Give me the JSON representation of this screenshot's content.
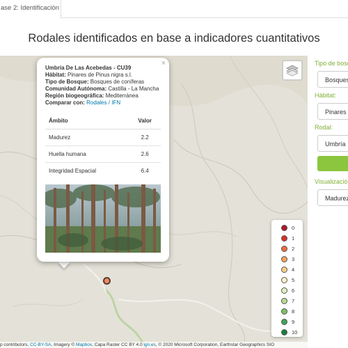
{
  "tab": {
    "label": "ase 2: Identificación"
  },
  "page_title": "Rodales identificados en base a indicadores cuantitativos",
  "popup": {
    "close": "×",
    "name": "Umbría De Las Acebedas - CU39",
    "habitat_label": "Hábitat:",
    "habitat_value": "Pinares de Pinus nigra s.l.",
    "forest_label": "Tipo de Bosque:",
    "forest_value": "Bosques de coníferas",
    "community_label": "Comunidad Autónoma:",
    "community_value": "Castilla - La Mancha",
    "region_label": "Región biogeográfica:",
    "region_value": "Mediterránea",
    "compare_label": "Comparar con:",
    "compare_rodales": "Rodales",
    "compare_sep": "/",
    "compare_ifn": "IFN",
    "table": {
      "headers": [
        "Ámbito",
        "Valor"
      ],
      "rows": [
        {
          "ambito": "Madurez",
          "valor": "2.2"
        },
        {
          "ambito": "Huella humana",
          "valor": "2.6"
        },
        {
          "ambito": "Integridad Espacial",
          "valor": "6.4"
        }
      ]
    }
  },
  "legend": [
    {
      "label": "0",
      "color": "#b2182b"
    },
    {
      "label": "1",
      "color": "#d6312b"
    },
    {
      "label": "2",
      "color": "#ef6c3f"
    },
    {
      "label": "3",
      "color": "#f4a261"
    },
    {
      "label": "4",
      "color": "#f9d08a"
    },
    {
      "label": "5",
      "color": "#fbf3c4"
    },
    {
      "label": "6",
      "color": "#e1f0c0"
    },
    {
      "label": "7",
      "color": "#b5dc8c"
    },
    {
      "label": "8",
      "color": "#7dc361"
    },
    {
      "label": "9",
      "color": "#3fa454"
    },
    {
      "label": "10",
      "color": "#1a7d3b"
    }
  ],
  "marker_color": "#ef8a62",
  "attribution": {
    "prefix": "p contributors, ",
    "ccbysa": "CC-BY-SA",
    "imagery": ", Imagery © ",
    "mapbox": "Mapbox",
    "capa": ", Capa Raster CC BY 4.0 ",
    "iones": "ign.es",
    "rest": ", © 2020 Microsoft Corporation, Earthstar Geographics SIO"
  },
  "panel": {
    "tipo_label": "Tipo de bosq",
    "tipo_value": "Bosques",
    "habitat_label": "Hábitat:",
    "habitat_value": "Pinares",
    "rodal_label": "Rodal:",
    "rodal_value": "Umbría",
    "vis_label": "Visualizació",
    "vis_value": "Madurez"
  }
}
